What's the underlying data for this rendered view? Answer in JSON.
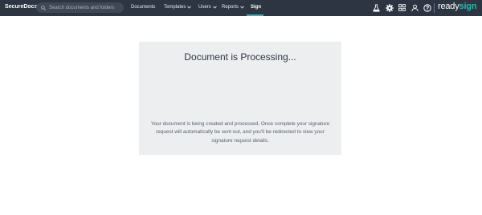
{
  "app": {
    "brand": "SecureDocs"
  },
  "search": {
    "placeholder": "Search documents and folders"
  },
  "nav": {
    "documents": "Documents",
    "templates": "Templates",
    "users": "Users",
    "reports": "Reports",
    "sign": "Sign"
  },
  "logo": {
    "ready": "ready",
    "sign": "sign"
  },
  "icons": [
    "flask-icon",
    "gear-icon",
    "apps-grid-icon",
    "user-icon",
    "help-icon"
  ],
  "colors": {
    "topbar": "#2d3542",
    "accent": "#2ab6b1",
    "card": "#eceef0"
  },
  "processing": {
    "title": "Document is Processing...",
    "message": "Your document is being created and processed. Once complete your signature request will automatically be sent out, and you'll be redirected to view your signature request details."
  }
}
